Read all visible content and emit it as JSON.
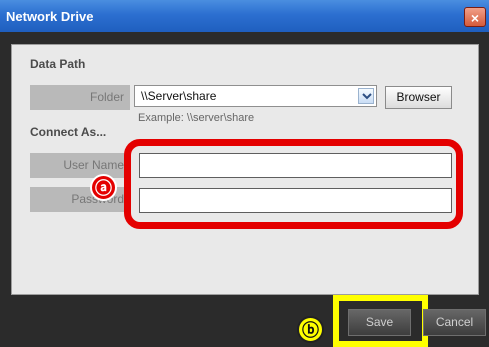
{
  "window": {
    "title": "Network Drive",
    "close_label": "×"
  },
  "data_path": {
    "section": "Data Path",
    "folder_label": "Folder",
    "folder_value": "\\\\Server\\share",
    "browse_label": "Browser",
    "example": "Example: \\\\server\\share"
  },
  "connect": {
    "section": "Connect As...",
    "user_label": "User Name",
    "user_value": "",
    "password_label": "Password",
    "password_value": ""
  },
  "annotations": {
    "a": "ⓐ",
    "b": "ⓑ"
  },
  "buttons": {
    "save": "Save",
    "cancel": "Cancel"
  },
  "colors": {
    "annotation_red": "#e40000",
    "annotation_yellow": "#ffff00",
    "title_blue": "#2c6fd0"
  }
}
